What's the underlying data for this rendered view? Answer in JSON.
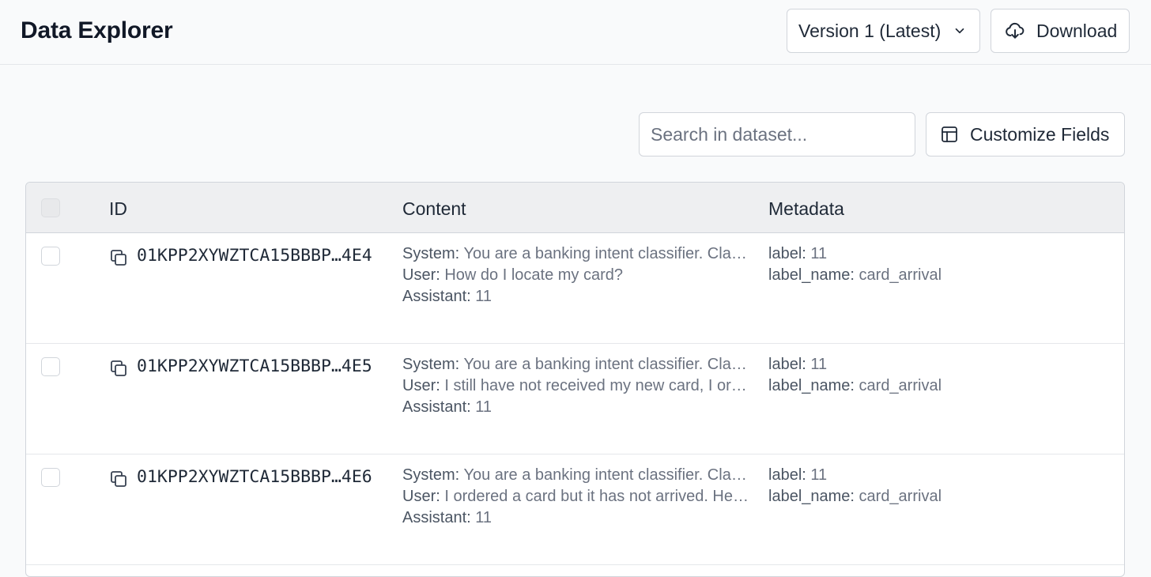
{
  "header": {
    "title": "Data Explorer",
    "version_label": "Version 1 (Latest)",
    "download_label": "Download"
  },
  "toolbar": {
    "search_placeholder": "Search in dataset...",
    "customize_label": "Customize Fields"
  },
  "table": {
    "columns": {
      "id": "ID",
      "content": "Content",
      "metadata": "Metadata"
    },
    "rows": [
      {
        "id": "01KPP2XYWZTCA15BBBP…4E4",
        "content": {
          "system_key": "System:",
          "system": "You are a banking intent classifier. Classify the customer query.",
          "user_key": "User:",
          "user": "How do I locate my card?",
          "assistant_key": "Assistant:",
          "assistant": "11"
        },
        "metadata": {
          "label_key": "label:",
          "label": "11",
          "label_name_key": "label_name:",
          "label_name": "card_arrival"
        }
      },
      {
        "id": "01KPP2XYWZTCA15BBBP…4E5",
        "content": {
          "system_key": "System:",
          "system": "You are a banking intent classifier. Classify the customer query.",
          "user_key": "User:",
          "user": "I still have not received my new card, I ordered it a while ago.",
          "assistant_key": "Assistant:",
          "assistant": "11"
        },
        "metadata": {
          "label_key": "label:",
          "label": "11",
          "label_name_key": "label_name:",
          "label_name": "card_arrival"
        }
      },
      {
        "id": "01KPP2XYWZTCA15BBBP…4E6",
        "content": {
          "system_key": "System:",
          "system": "You are a banking intent classifier. Classify the customer query.",
          "user_key": "User:",
          "user": "I ordered a card but it has not arrived. Help me please.",
          "assistant_key": "Assistant:",
          "assistant": "11"
        },
        "metadata": {
          "label_key": "label:",
          "label": "11",
          "label_name_key": "label_name:",
          "label_name": "card_arrival"
        }
      }
    ]
  }
}
